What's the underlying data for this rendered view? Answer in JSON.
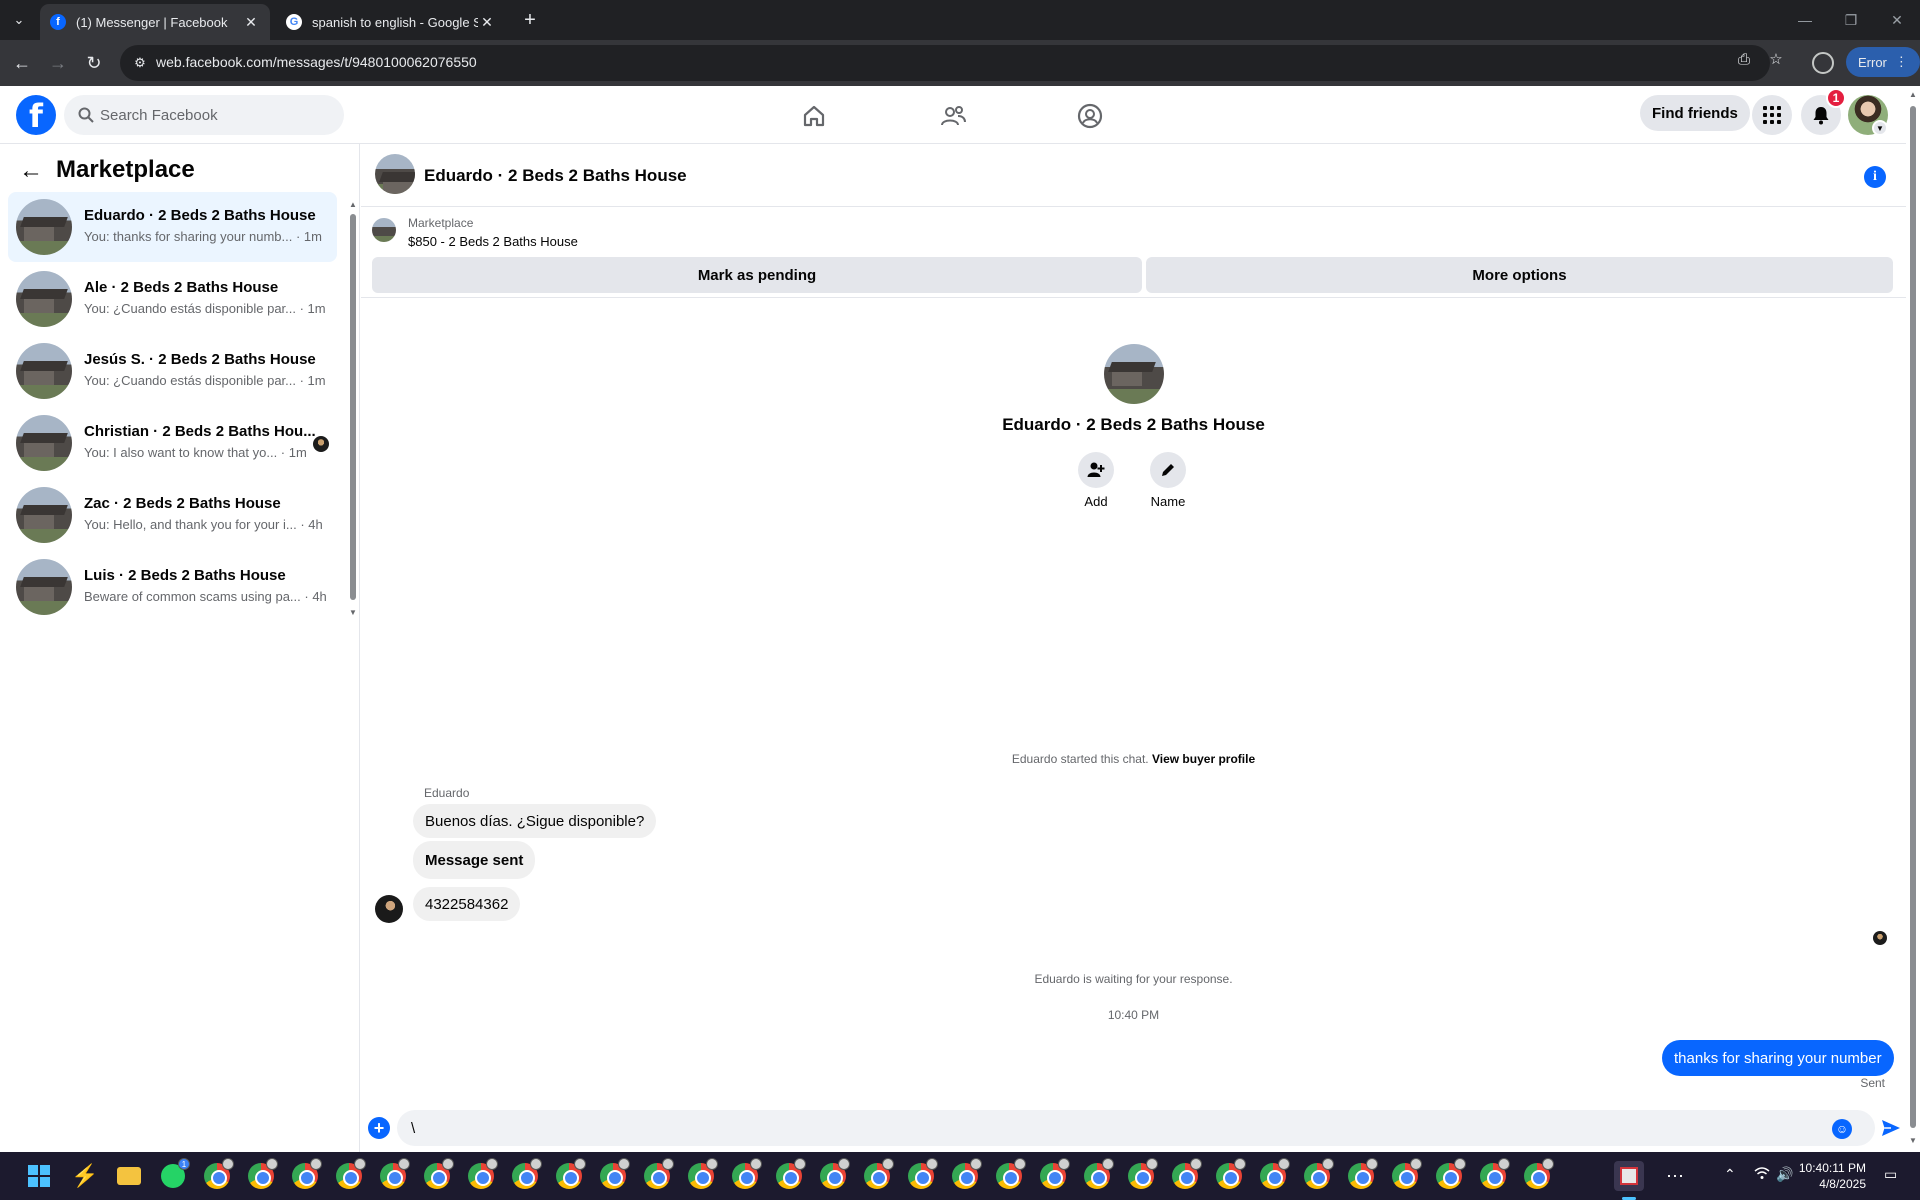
{
  "browser": {
    "tabs": [
      {
        "title": "(1) Messenger | Facebook",
        "active": true
      },
      {
        "title": "spanish to english - Google Sea",
        "active": false
      }
    ],
    "url": "web.facebook.com/messages/t/9480100062076550",
    "profile_button": "Error"
  },
  "fb": {
    "search_placeholder": "Search Facebook",
    "find_friends": "Find friends",
    "notification_count": "1",
    "brand_color": "#0866ff"
  },
  "sidebar": {
    "title": "Marketplace",
    "conversations": [
      {
        "name": "Eduardo · 2 Beds 2 Baths House",
        "snippet": "You: thanks for sharing your numb... · 1m",
        "selected": true
      },
      {
        "name": "Ale · 2 Beds 2 Baths House",
        "snippet": "You: ¿Cuando estás disponible par... · 1m"
      },
      {
        "name": "Jesús S. · 2 Beds 2 Baths House",
        "snippet": "You: ¿Cuando estás disponible par... · 1m"
      },
      {
        "name": "Christian · 2 Beds 2 Baths Hou...",
        "snippet": "You: I also want to know that yo... · 1m"
      },
      {
        "name": "Zac · 2 Beds 2 Baths House",
        "snippet": "You: Hello, and thank you for your i... · 4h"
      },
      {
        "name": "Luis · 2 Beds 2 Baths House",
        "snippet": "Beware of common scams using pa... · 4h"
      }
    ]
  },
  "chat": {
    "title": "Eduardo · 2 Beds 2 Baths House",
    "listing": {
      "label": "Marketplace",
      "price_title": "$850 - 2 Beds 2 Baths House",
      "mark_pending": "Mark as pending",
      "more_options": "More options"
    },
    "profile": {
      "name": "Eduardo · 2 Beds 2 Baths House",
      "add": "Add",
      "rename": "Name"
    },
    "started_text": "Eduardo started this chat.",
    "view_profile": "View buyer profile",
    "sender": "Eduardo",
    "messages_in": [
      "Buenos días. ¿Sigue disponible?",
      "Message sent",
      "4322584362"
    ],
    "waiting_text": "Eduardo is waiting for your response.",
    "time": "10:40 PM",
    "message_out": "thanks for sharing your number",
    "status": "Sent",
    "composer_value": "\\"
  },
  "taskbar": {
    "time": "10:40:11 PM",
    "date": "4/8/2025",
    "whatsapp_badge": "1"
  }
}
